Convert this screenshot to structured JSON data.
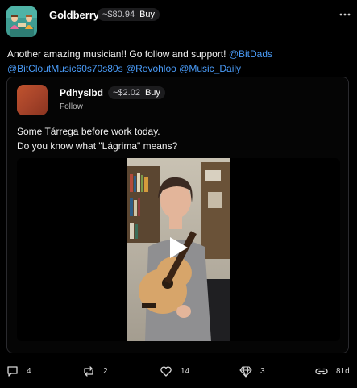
{
  "post": {
    "username": "Goldberry",
    "coin_price": "~$80.94",
    "buy_label": "Buy",
    "more_icon": "ellipsis-icon",
    "text_plain": "Another amazing musician!! Go follow and support! ",
    "mentions": [
      "@BitDads",
      "@BitCloutMusic60s70s80s",
      "@Revohloo",
      "@Music_Daily"
    ]
  },
  "quoted": {
    "username": "Pdhyslbd",
    "coin_price": "~$2.02",
    "buy_label": "Buy",
    "follow_label": "Follow",
    "line1": "Some Tárrega before work today.",
    "line2": "Do you know what \"Lágrima\" means?",
    "video_icon": "play-icon"
  },
  "actions": {
    "comments": "4",
    "reposts": "2",
    "likes": "14",
    "diamonds": "3",
    "age": "81d"
  },
  "colors": {
    "background": "#000000",
    "mention": "#4a9bf7",
    "pill": "#1c1c1e",
    "border": "#2a2a2e"
  }
}
